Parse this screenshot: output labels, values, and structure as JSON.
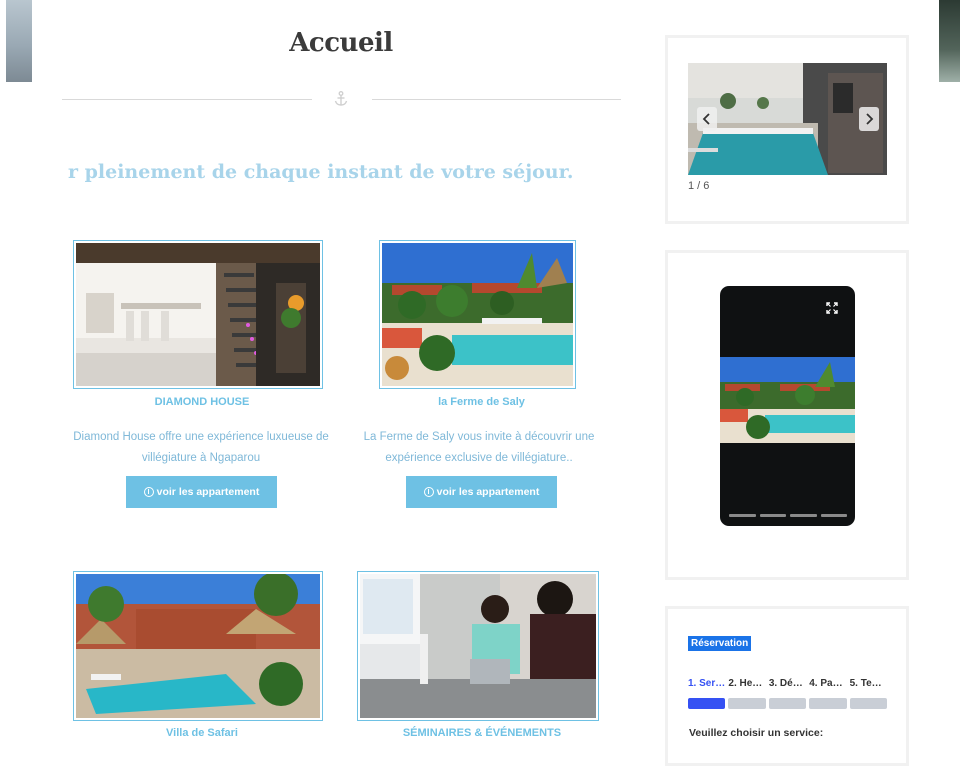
{
  "page": {
    "title": "Accueil",
    "tagline": "r pleinement de chaque instant de votre séjour."
  },
  "icons": {
    "divider": "anchor-icon",
    "button": "circle-arrow-down-icon",
    "slider_prev": "chevron-left-icon",
    "slider_next": "chevron-right-icon",
    "story_expand": "expand-icon"
  },
  "colors": {
    "accent": "#6ec1e4",
    "tagline": "#a8d4ea",
    "booking_accent": "#3551f3",
    "badge": "#1a73e8"
  },
  "properties": [
    {
      "title": "DIAMOND HOUSE",
      "description": "Diamond House offre une expérience luxueuse de villégiature à Ngaparou",
      "button_label": "voir les appartement"
    },
    {
      "title": "la Ferme de Saly",
      "description": "La Ferme de Saly vous invite à découvrir une expérience exclusive de villégiature..",
      "button_label": "voir les appartement"
    },
    {
      "title": "Villa de Safari"
    },
    {
      "title": "SÉMINAIRES & ÉVÉNEMENTS"
    }
  ],
  "sidebar": {
    "slider": {
      "counter": "1 / 6"
    },
    "story": {
      "segments": 4
    },
    "booking": {
      "badge": "Réservation",
      "steps": [
        {
          "label": "1. Ser…",
          "active": true
        },
        {
          "label": "2. He…",
          "active": false
        },
        {
          "label": "3. Dé…",
          "active": false
        },
        {
          "label": "4. Pa…",
          "active": false
        },
        {
          "label": "5. Te…",
          "active": false
        }
      ],
      "prompt": "Veuillez choisir un service:"
    }
  }
}
